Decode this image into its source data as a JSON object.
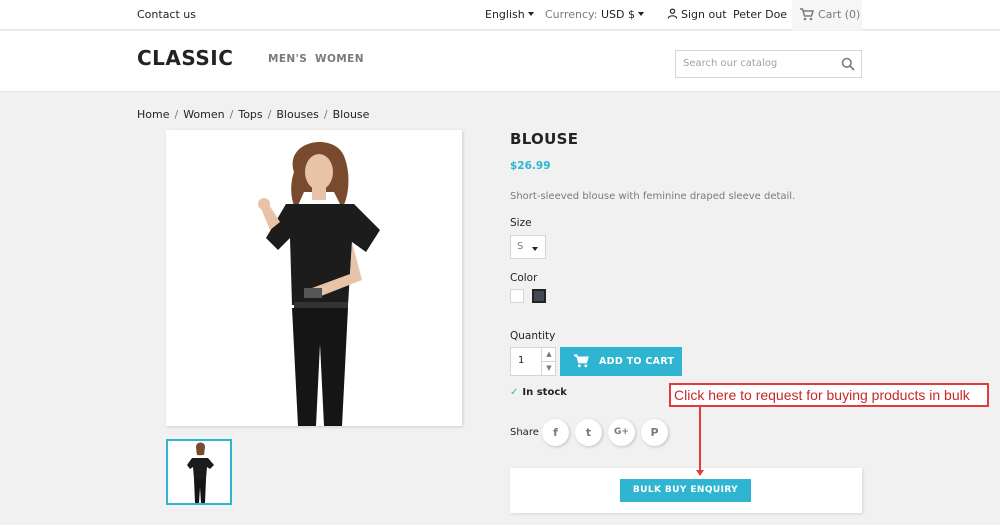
{
  "topbar": {
    "contact": "Contact us",
    "language": "English",
    "currency_label": "Currency:",
    "currency_value": "USD $",
    "sign_out": "Sign out",
    "user_name": "Peter Doe",
    "cart": "Cart (0)"
  },
  "header": {
    "logo": "CLASSIC",
    "nav": [
      "MEN'S",
      "WOMEN"
    ],
    "search_placeholder": "Search our catalog"
  },
  "breadcrumb": [
    "Home",
    "Women",
    "Tops",
    "Blouses",
    "Blouse"
  ],
  "product": {
    "title": "BLOUSE",
    "price": "$26.99",
    "description": "Short-sleeved blouse with feminine draped sleeve detail.",
    "size_label": "Size",
    "size_value": "S",
    "color_label": "Color",
    "colors": [
      "#ffffff",
      "#434a54"
    ],
    "quantity_label": "Quantity",
    "quantity_value": "1",
    "add_to_cart": "ADD TO CART",
    "stock": "In stock",
    "share_label": "Share",
    "share_icons": [
      "facebook-icon",
      "twitter-icon",
      "google-plus-icon",
      "pinterest-icon"
    ],
    "share_glyphs": [
      "f",
      "t",
      "G+",
      "P"
    ]
  },
  "bulk": {
    "button": "BULK BUY ENQUIRY"
  },
  "annotation": {
    "text": "Click here to request for buying products in bulk"
  },
  "colors": {
    "accent": "#2fb5d2",
    "annotation_red": "#e23b3b",
    "stock_green": "#4cbb6c"
  }
}
